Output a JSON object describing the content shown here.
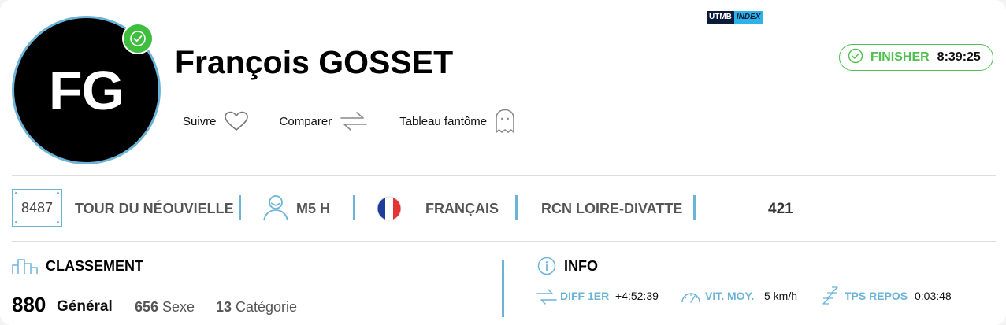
{
  "runner": {
    "initials": "FG",
    "name": "François GOSSET"
  },
  "actions": {
    "follow": "Suivre",
    "compare": "Comparer",
    "ghost": "Tableau fantôme"
  },
  "status": {
    "label": "FINISHER",
    "time": "8:39:25",
    "color": "#4fc04f"
  },
  "details": {
    "bib": "8487",
    "race": "TOUR DU NÉOUVIELLE",
    "category": "M5 H",
    "nationality": "FRANÇAIS",
    "club": "RCN LOIRE-DIVATTE",
    "utmb_label_1": "UTMB",
    "utmb_label_2": "INDEX",
    "utmb_index": "421"
  },
  "ranking": {
    "title": "CLASSEMENT",
    "general_value": "880",
    "general_label": "Général",
    "sex_value": "656",
    "sex_label": "Sexe",
    "cat_value": "13",
    "cat_label": "Catégorie"
  },
  "info": {
    "title": "INFO",
    "diff_label": "DIFF 1ER",
    "diff_value": "+4:52:39",
    "speed_label": "VIT. MOY.",
    "speed_value": "5 km/h",
    "rest_label": "TPS REPOS",
    "rest_value": "0:03:48"
  },
  "colors": {
    "accent": "#6bb4d8",
    "finisher": "#4fc04f"
  }
}
